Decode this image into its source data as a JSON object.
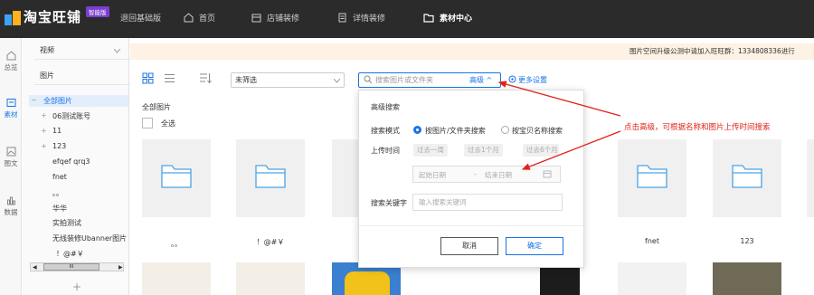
{
  "topbar": {
    "brand": "淘宝旺铺",
    "badge": "智能版",
    "nav": [
      {
        "label": "退回基础版"
      },
      {
        "label": "首页"
      },
      {
        "label": "店铺装修"
      },
      {
        "label": "详情装修"
      },
      {
        "label": "素材中心"
      }
    ]
  },
  "rail": [
    {
      "label": "总览",
      "icon": "home-icon"
    },
    {
      "label": "素材",
      "icon": "folder-icon"
    },
    {
      "label": "图文",
      "icon": "image-text-icon"
    },
    {
      "label": "数据",
      "icon": "chart-icon"
    }
  ],
  "tree": {
    "video": "视频",
    "image": "图片",
    "items": [
      "全部图片",
      "06测试账号",
      "11",
      "123",
      "efqef qrq3",
      "fnet",
      "。。",
      "华华",
      "实拍测试",
      "无线装修Ubanner图片",
      "！@#￥"
    ],
    "scroll_label": "III",
    "add_label": "+"
  },
  "notice": "图片空间升级公测中请加入旺旺群：1334808336进行",
  "toolbar": {
    "filter": "未筛选",
    "search_placeholder": "搜索图片或文件夹",
    "advanced": "高级",
    "more_settings": "更多设置"
  },
  "gallery": {
    "title": "全部图片",
    "select_all": "全选",
    "folders": [
      "。。",
      "！@#￥",
      "",
      "",
      "",
      "fnet",
      "123"
    ]
  },
  "advanced_search": {
    "title": "高级搜索",
    "mode_label": "搜索模式",
    "mode_options": [
      "按图片/文件夹搜索",
      "按宝贝名称搜索"
    ],
    "upload_time_label": "上传时间",
    "time_chips": [
      "过去一周",
      "过去1个月",
      "过去6个月"
    ],
    "date_start": "起始日期",
    "date_sep": "-",
    "date_end": "结束日期",
    "keyword_label": "搜索关键字",
    "keyword_placeholder": "输入搜索关键词",
    "cancel": "取消",
    "confirm": "确定"
  },
  "annotation": "点击高级，可根据名称和图片上传时间搜索",
  "colors": {
    "accent": "#1a73e8",
    "topbar": "#2b2b2b",
    "annotation": "#e0221a",
    "badge": "#7a3fd1"
  }
}
